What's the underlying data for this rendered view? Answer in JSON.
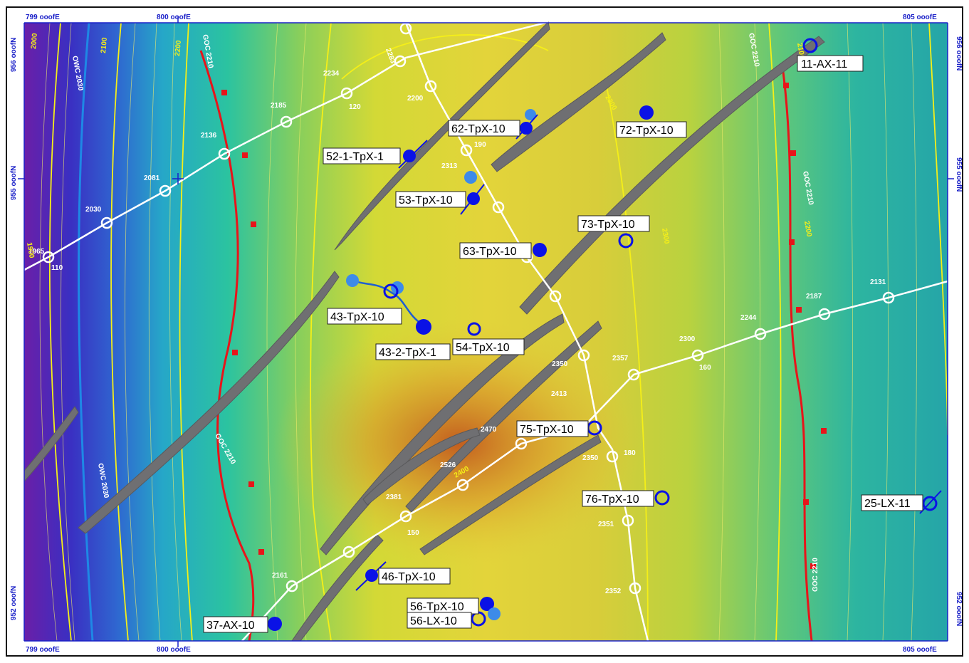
{
  "grid": {
    "x_labels": [
      {
        "text": "799 ooofE",
        "pos": "left"
      },
      {
        "text": "800 ooofE",
        "pos": "mid"
      },
      {
        "text": "805 ooofE",
        "pos": "right"
      }
    ],
    "y_labels": [
      "956 ooofN",
      "955 ooofN",
      "952 ooofN"
    ]
  },
  "colors": {
    "goc_line": "#e8141a",
    "owc_line": "#1e88e5",
    "contour": "#f5ef18",
    "fault": "#6f6f72",
    "well_fill": "#0a12e6",
    "grid_text": "#1a20c8"
  },
  "fluid_contacts": {
    "goc": "GOC 2210",
    "owc": "OWC 2030"
  },
  "contour_labels": [
    "1900",
    "2000",
    "2100",
    "2200",
    "2300",
    "2400",
    "2030",
    "2100",
    "2200",
    "2300"
  ],
  "wells": [
    {
      "name": "11-AX-11",
      "symbol": "circle-open"
    },
    {
      "name": "62-TpX-10",
      "symbol": "filled-deviated"
    },
    {
      "name": "72-TpX-10",
      "symbol": "filled"
    },
    {
      "name": "52-1-TpX-1",
      "symbol": "filled-deviated"
    },
    {
      "name": "53-TpX-10",
      "symbol": "filled-deviated"
    },
    {
      "name": "73-TpX-10",
      "symbol": "circle-open"
    },
    {
      "name": "63-TpX-10",
      "symbol": "filled"
    },
    {
      "name": "43-TpX-10",
      "symbol": "circle-open"
    },
    {
      "name": "43-2-TpX-1",
      "symbol": "filled"
    },
    {
      "name": "54-TpX-10",
      "symbol": "circle-open"
    },
    {
      "name": "75-TpX-10",
      "symbol": "circle-open"
    },
    {
      "name": "76-TpX-10",
      "symbol": "circle-open"
    },
    {
      "name": "25-LX-11",
      "symbol": "circle-open"
    },
    {
      "name": "46-TpX-10",
      "symbol": "filled-deviated"
    },
    {
      "name": "56-TpX-10",
      "symbol": "filled"
    },
    {
      "name": "56-LX-10",
      "symbol": "circle-open"
    },
    {
      "name": "37-AX-10",
      "symbol": "filled"
    }
  ],
  "section_stations": {
    "line_nw_se": [
      "2200",
      "2283",
      "2200",
      "2313",
      "190"
    ],
    "line_sw_ne": [
      "1965",
      "110",
      "2030",
      "2081",
      "2136",
      "2185",
      "2234",
      "120"
    ],
    "line_south_a": [
      "2161",
      "2381",
      "150",
      "2526",
      "2470",
      "2413",
      "2350",
      "2357",
      "2300",
      "160",
      "2244",
      "2187",
      "2131"
    ],
    "line_south_b": [
      "2350",
      "180",
      "2351",
      "2352"
    ]
  }
}
